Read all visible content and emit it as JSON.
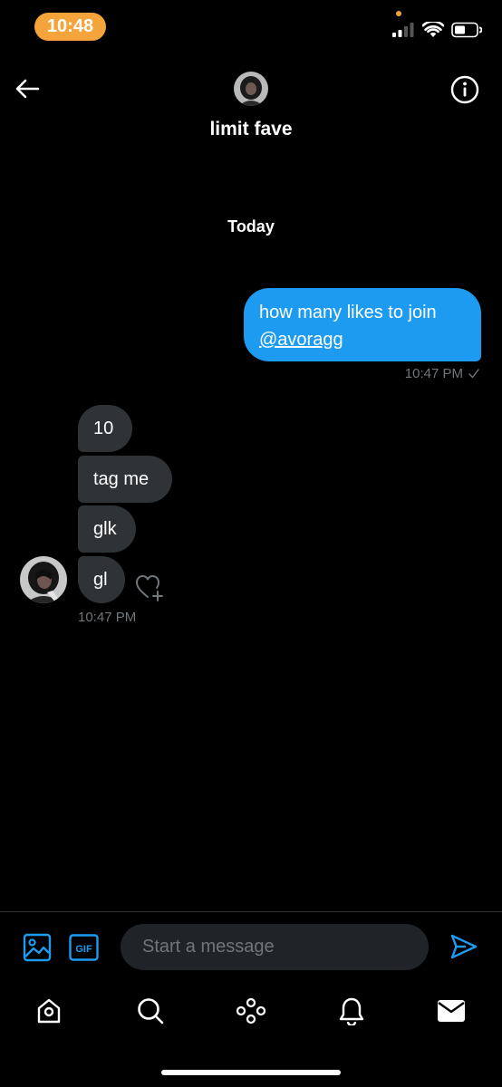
{
  "status_bar": {
    "time": "10:48",
    "accent": "#f4a43a",
    "icons": [
      "cellular-signal-icon",
      "wifi-icon",
      "battery-icon"
    ]
  },
  "header": {
    "name": "limit fave",
    "back_icon": "back-arrow-icon",
    "info_icon": "info-icon"
  },
  "conversation": {
    "date_divider": "Today",
    "outgoing": [
      {
        "text": "how many likes to join",
        "mention": "@avoragg",
        "time": "10:47 PM",
        "status_icon": "sent-check-icon"
      }
    ],
    "incoming_group": {
      "messages": [
        "10",
        "tag me",
        "glk",
        "gl"
      ],
      "time": "10:47 PM",
      "reaction_icon": "add-reaction-heart-icon"
    }
  },
  "composer": {
    "placeholder": "Start a message",
    "value": "",
    "media_icon": "image-icon",
    "gif_label": "GIF",
    "send_icon": "send-icon"
  },
  "tab_bar": {
    "items": [
      "home-icon",
      "search-icon",
      "spaces-icon",
      "notifications-icon",
      "messages-icon"
    ],
    "active": "messages-icon"
  },
  "colors": {
    "background": "#000000",
    "accent_blue": "#1d9bf0",
    "bubble_gray": "#2f3336",
    "muted_text": "#71767b"
  }
}
